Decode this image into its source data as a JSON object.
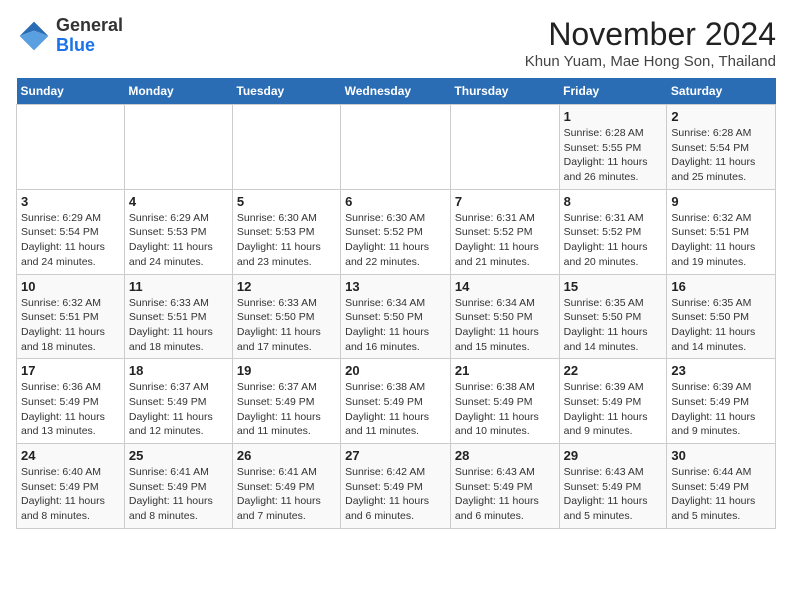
{
  "header": {
    "logo_general": "General",
    "logo_blue": "Blue",
    "month_title": "November 2024",
    "location": "Khun Yuam, Mae Hong Son, Thailand"
  },
  "weekdays": [
    "Sunday",
    "Monday",
    "Tuesday",
    "Wednesday",
    "Thursday",
    "Friday",
    "Saturday"
  ],
  "weeks": [
    [
      {
        "day": "",
        "info": ""
      },
      {
        "day": "",
        "info": ""
      },
      {
        "day": "",
        "info": ""
      },
      {
        "day": "",
        "info": ""
      },
      {
        "day": "",
        "info": ""
      },
      {
        "day": "1",
        "info": "Sunrise: 6:28 AM\nSunset: 5:55 PM\nDaylight: 11 hours and 26 minutes."
      },
      {
        "day": "2",
        "info": "Sunrise: 6:28 AM\nSunset: 5:54 PM\nDaylight: 11 hours and 25 minutes."
      }
    ],
    [
      {
        "day": "3",
        "info": "Sunrise: 6:29 AM\nSunset: 5:54 PM\nDaylight: 11 hours and 24 minutes."
      },
      {
        "day": "4",
        "info": "Sunrise: 6:29 AM\nSunset: 5:53 PM\nDaylight: 11 hours and 24 minutes."
      },
      {
        "day": "5",
        "info": "Sunrise: 6:30 AM\nSunset: 5:53 PM\nDaylight: 11 hours and 23 minutes."
      },
      {
        "day": "6",
        "info": "Sunrise: 6:30 AM\nSunset: 5:52 PM\nDaylight: 11 hours and 22 minutes."
      },
      {
        "day": "7",
        "info": "Sunrise: 6:31 AM\nSunset: 5:52 PM\nDaylight: 11 hours and 21 minutes."
      },
      {
        "day": "8",
        "info": "Sunrise: 6:31 AM\nSunset: 5:52 PM\nDaylight: 11 hours and 20 minutes."
      },
      {
        "day": "9",
        "info": "Sunrise: 6:32 AM\nSunset: 5:51 PM\nDaylight: 11 hours and 19 minutes."
      }
    ],
    [
      {
        "day": "10",
        "info": "Sunrise: 6:32 AM\nSunset: 5:51 PM\nDaylight: 11 hours and 18 minutes."
      },
      {
        "day": "11",
        "info": "Sunrise: 6:33 AM\nSunset: 5:51 PM\nDaylight: 11 hours and 18 minutes."
      },
      {
        "day": "12",
        "info": "Sunrise: 6:33 AM\nSunset: 5:50 PM\nDaylight: 11 hours and 17 minutes."
      },
      {
        "day": "13",
        "info": "Sunrise: 6:34 AM\nSunset: 5:50 PM\nDaylight: 11 hours and 16 minutes."
      },
      {
        "day": "14",
        "info": "Sunrise: 6:34 AM\nSunset: 5:50 PM\nDaylight: 11 hours and 15 minutes."
      },
      {
        "day": "15",
        "info": "Sunrise: 6:35 AM\nSunset: 5:50 PM\nDaylight: 11 hours and 14 minutes."
      },
      {
        "day": "16",
        "info": "Sunrise: 6:35 AM\nSunset: 5:50 PM\nDaylight: 11 hours and 14 minutes."
      }
    ],
    [
      {
        "day": "17",
        "info": "Sunrise: 6:36 AM\nSunset: 5:49 PM\nDaylight: 11 hours and 13 minutes."
      },
      {
        "day": "18",
        "info": "Sunrise: 6:37 AM\nSunset: 5:49 PM\nDaylight: 11 hours and 12 minutes."
      },
      {
        "day": "19",
        "info": "Sunrise: 6:37 AM\nSunset: 5:49 PM\nDaylight: 11 hours and 11 minutes."
      },
      {
        "day": "20",
        "info": "Sunrise: 6:38 AM\nSunset: 5:49 PM\nDaylight: 11 hours and 11 minutes."
      },
      {
        "day": "21",
        "info": "Sunrise: 6:38 AM\nSunset: 5:49 PM\nDaylight: 11 hours and 10 minutes."
      },
      {
        "day": "22",
        "info": "Sunrise: 6:39 AM\nSunset: 5:49 PM\nDaylight: 11 hours and 9 minutes."
      },
      {
        "day": "23",
        "info": "Sunrise: 6:39 AM\nSunset: 5:49 PM\nDaylight: 11 hours and 9 minutes."
      }
    ],
    [
      {
        "day": "24",
        "info": "Sunrise: 6:40 AM\nSunset: 5:49 PM\nDaylight: 11 hours and 8 minutes."
      },
      {
        "day": "25",
        "info": "Sunrise: 6:41 AM\nSunset: 5:49 PM\nDaylight: 11 hours and 8 minutes."
      },
      {
        "day": "26",
        "info": "Sunrise: 6:41 AM\nSunset: 5:49 PM\nDaylight: 11 hours and 7 minutes."
      },
      {
        "day": "27",
        "info": "Sunrise: 6:42 AM\nSunset: 5:49 PM\nDaylight: 11 hours and 6 minutes."
      },
      {
        "day": "28",
        "info": "Sunrise: 6:43 AM\nSunset: 5:49 PM\nDaylight: 11 hours and 6 minutes."
      },
      {
        "day": "29",
        "info": "Sunrise: 6:43 AM\nSunset: 5:49 PM\nDaylight: 11 hours and 5 minutes."
      },
      {
        "day": "30",
        "info": "Sunrise: 6:44 AM\nSunset: 5:49 PM\nDaylight: 11 hours and 5 minutes."
      }
    ]
  ]
}
